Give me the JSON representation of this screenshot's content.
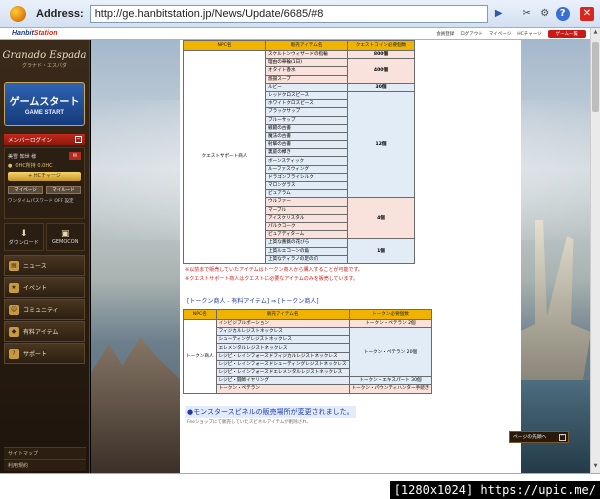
{
  "browser": {
    "address_label": "Address:",
    "url": "http://ge.hanbitstation.jp/News/Update/6685/#8"
  },
  "site": {
    "brand_prefix": "Hanbit",
    "brand_suffix": "Station",
    "links": [
      "会員登録",
      "ログアウト",
      "マイページ",
      "HCチャージ"
    ],
    "game_start_top": "ゲーム一覧"
  },
  "sidebar": {
    "logo_main": "Granado Espada",
    "logo_sub": "グラナド・エスパダ",
    "start_jp": "ゲームスタート",
    "start_en": "GAME START",
    "login_label": "メンバーログイン",
    "user_name": "美雪 知世 様",
    "coin_line": "0HC所持 0.0HC",
    "charge": "+ HCチャージ",
    "mypage": "マイページ",
    "mycode": "マイルード",
    "otp": "ワンタイムパスワード OFF 設定",
    "download": "ダウンロード",
    "gemocon": "GEMOCON",
    "nav": [
      "ニュース",
      "イベント",
      "コミュニティ",
      "有料アイテム",
      "サポート"
    ],
    "footer": [
      "サイトマップ",
      "利用規約"
    ]
  },
  "table1": {
    "headers": [
      "NPC名",
      "販売アイテム名",
      "クエストコイン必要個数"
    ],
    "npc": "クエストサポート商人",
    "groups": [
      {
        "items": [
          "スケルトンウィザードの指輪"
        ],
        "count": "800個",
        "tone": "pink"
      },
      {
        "items": [
          "理由の華輪(1日)",
          "オタイト香水",
          "悠揚スープ"
        ],
        "count": "400個",
        "tone": "pink"
      },
      {
        "items": [
          "ルビー"
        ],
        "count": "30個",
        "tone": "blue"
      },
      {
        "items": [
          "レッドクロスピース",
          "ホワイトクロスピース",
          "ブラックサップ",
          "ブルーサップ",
          "戦闘の古書",
          "魔法の古書",
          "射撃の古書",
          "裏庭の欅き",
          "ボーンスティック",
          "ルーファスウィング",
          "ドラゴンフライシルク",
          "マロングラス",
          "ピュアラム"
        ],
        "count": "12個",
        "tone": "blue"
      },
      {
        "items": [
          "ウルファー",
          "マーブル",
          "アイスクリスタル",
          "パルクコーク",
          "ピュアディターム"
        ],
        "count": "4個",
        "tone": "pink"
      },
      {
        "items": [
          "上質な薔薇の花びら",
          "上質ルエコーンの角",
          "上質なティラノの足の爪"
        ],
        "count": "1個",
        "tone": "blue"
      }
    ],
    "notes": [
      "※以前まで販売していたアイテムはトークン商人から購入することが可能です。",
      "※クエストサポート商人はクエストに必要なアイテムのみを販売しています。"
    ]
  },
  "section_link": "[トークン商人 - 有料アイテム] ⇒ [トークン商人]",
  "table2": {
    "headers": [
      "NPC名",
      "販売アイテム名",
      "トークン必要個数"
    ],
    "npc": "トークン商人",
    "rows": [
      {
        "item": "インビジブルポーション",
        "count": "トークン・ペテラン 2個",
        "tone": "pink"
      },
      {
        "item": "フィジカルレジストネックレス",
        "count": "",
        "tone": "blue"
      },
      {
        "item": "シューティングレジストネックレス",
        "count": "",
        "tone": "blue"
      },
      {
        "item": "エレメンタルレジストネックレス",
        "count": "",
        "tone": "blue"
      },
      {
        "item": "レジピ・レインフォースドフィジカルレジストネックレス",
        "count": "トークン・ペテラン 20個",
        "tone": "blue"
      },
      {
        "item": "レジピ・レインフォースドシューティングレジストネックレス",
        "count": "",
        "tone": "blue"
      },
      {
        "item": "レジピ・レインフォースドエレメンタルレジストネックレス",
        "count": "",
        "tone": "blue"
      },
      {
        "item": "レジピ・闘師イヤリング",
        "count": "トークン・エキスパート 30個",
        "tone": "blue"
      },
      {
        "item": "トークン・ペテラン",
        "count": "トークン・パウンティハンター手続き",
        "tone": "pink"
      }
    ]
  },
  "bullet_title": "●モンスタースピネルの販売場所が変更されました。",
  "bullet_sub": "Feeショップにて販売していたスピネルアイテムが削除され、",
  "to_top": "ページの先頭へ",
  "watermark": "[1280x1024] https://upic.me/"
}
